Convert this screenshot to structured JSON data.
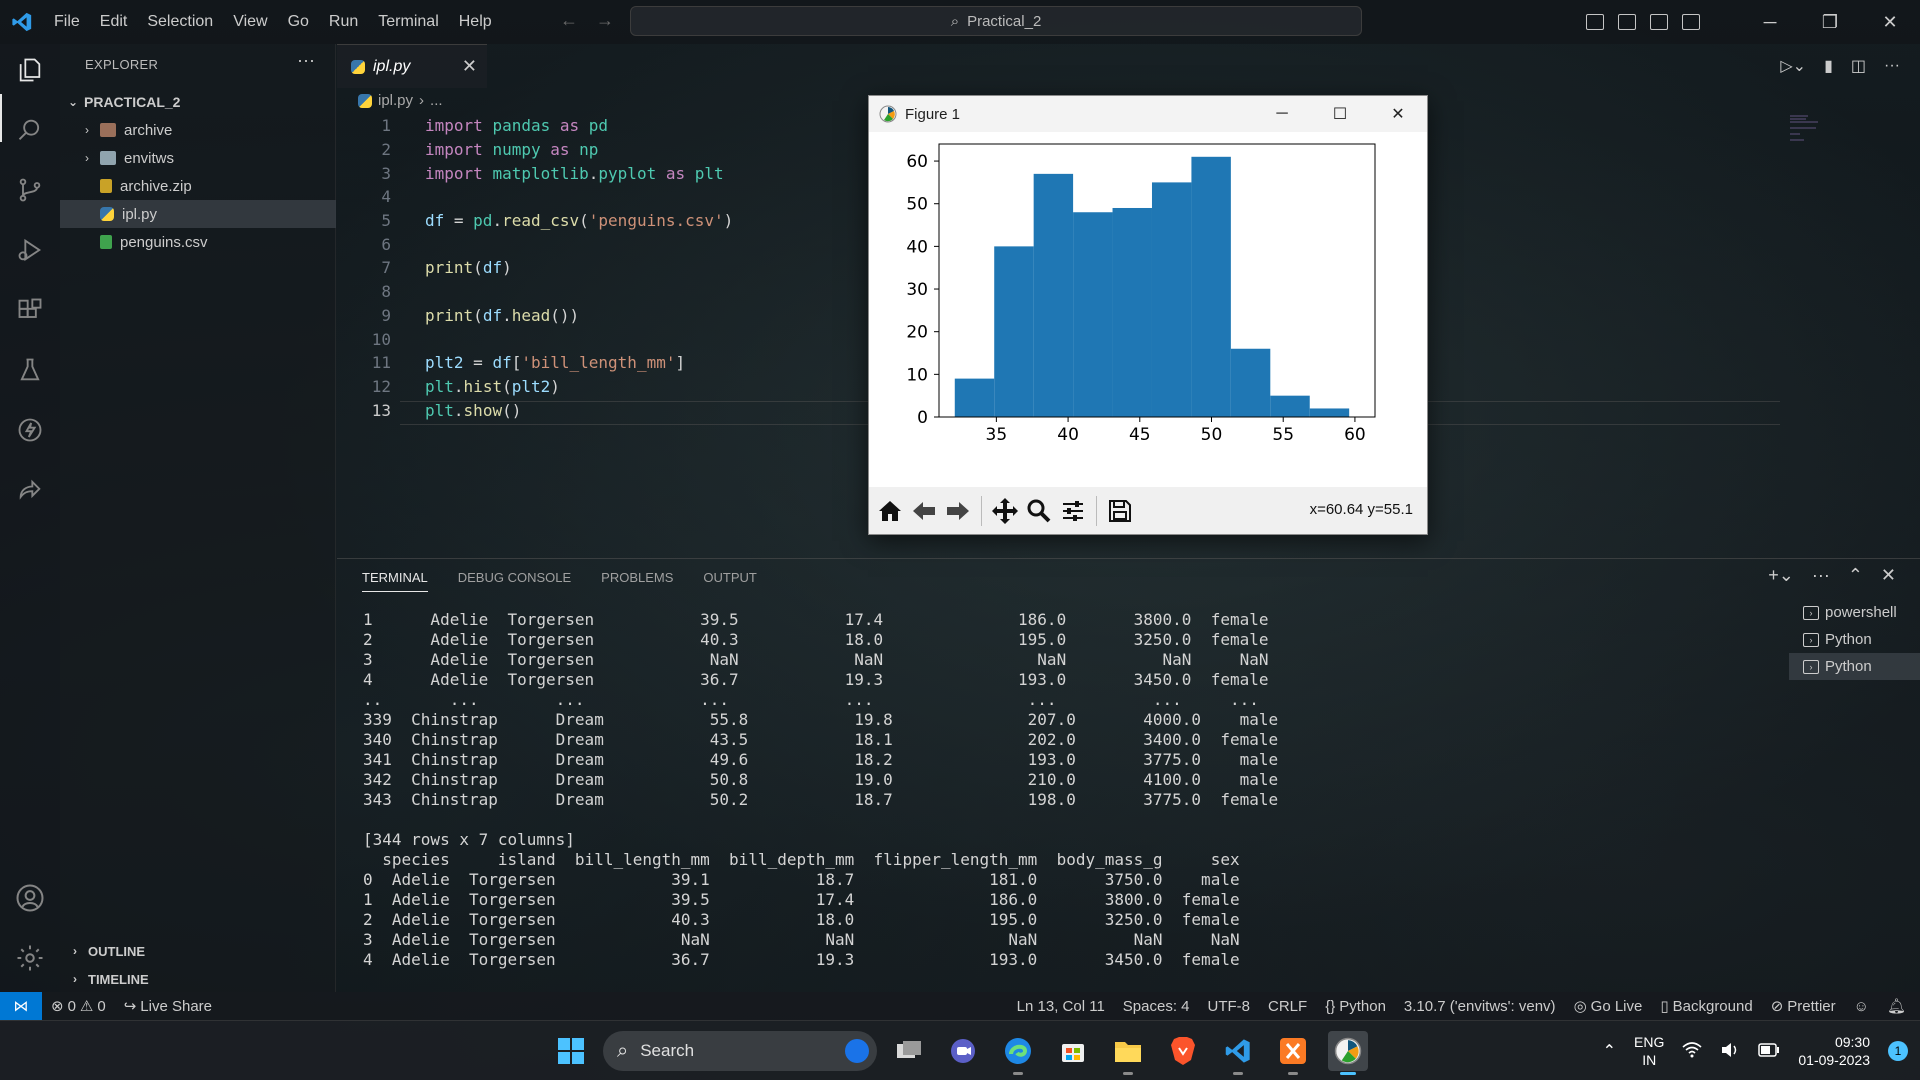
{
  "titlebar": {
    "menu": [
      "File",
      "Edit",
      "Selection",
      "View",
      "Go",
      "Run",
      "Terminal",
      "Help"
    ],
    "search_text": "Practical_2"
  },
  "sidebar": {
    "title": "EXPLORER",
    "project": "PRACTICAL_2",
    "items": [
      {
        "label": "archive",
        "kind": "folder"
      },
      {
        "label": "envitws",
        "kind": "folder"
      },
      {
        "label": "archive.zip",
        "kind": "zip"
      },
      {
        "label": "ipl.py",
        "kind": "python"
      },
      {
        "label": "penguins.csv",
        "kind": "csv"
      }
    ],
    "outline": "OUTLINE",
    "timeline": "TIMELINE"
  },
  "editor": {
    "tab_label": "ipl.py",
    "breadcrumb_file": "ipl.py",
    "breadcrumb_more": "...",
    "current_line": 13,
    "lines": [
      "import pandas as pd",
      "import numpy as np",
      "import matplotlib.pyplot as plt",
      "",
      "df = pd.read_csv('penguins.csv')",
      "",
      "print(df)",
      "",
      "print(df.head())",
      "",
      "plt2 = df['bill_length_mm']",
      "plt.hist(plt2)",
      "plt.show()"
    ]
  },
  "figure": {
    "title": "Figure 1",
    "coords": "x=60.64 y=55.1",
    "chart_data": {
      "type": "bar",
      "title": "",
      "xlabel": "",
      "ylabel": "",
      "x_ticks": [
        35,
        40,
        45,
        50,
        55,
        60
      ],
      "y_ticks": [
        0,
        10,
        20,
        30,
        40,
        50,
        60
      ],
      "xlim": [
        31.0,
        61.4
      ],
      "ylim": [
        0,
        64
      ],
      "bin_edges": [
        32.1,
        34.85,
        37.6,
        40.35,
        43.1,
        45.85,
        48.6,
        51.35,
        54.1,
        56.85,
        59.6
      ],
      "values": [
        9,
        40,
        57,
        48,
        49,
        55,
        61,
        16,
        5,
        2
      ],
      "color": "#1f77b4"
    }
  },
  "panel": {
    "tabs": [
      "TERMINAL",
      "DEBUG CONSOLE",
      "PROBLEMS",
      "OUTPUT"
    ],
    "terminal_lines": [
      "1      Adelie  Torgersen           39.5           17.4              186.0       3800.0  female",
      "2      Adelie  Torgersen           40.3           18.0              195.0       3250.0  female",
      "3      Adelie  Torgersen            NaN            NaN                NaN          NaN     NaN",
      "4      Adelie  Torgersen           36.7           19.3              193.0       3450.0  female",
      "..       ...        ...            ...            ...                ...          ...     ...",
      "339  Chinstrap      Dream           55.8           19.8              207.0       4000.0    male",
      "340  Chinstrap      Dream           43.5           18.1              202.0       3400.0  female",
      "341  Chinstrap      Dream           49.6           18.2              193.0       3775.0    male",
      "342  Chinstrap      Dream           50.8           19.0              210.0       4100.0    male",
      "343  Chinstrap      Dream           50.2           18.7              198.0       3775.0  female",
      "",
      "[344 rows x 7 columns]",
      "  species     island  bill_length_mm  bill_depth_mm  flipper_length_mm  body_mass_g     sex",
      "0  Adelie  Torgersen            39.1           18.7              181.0       3750.0    male",
      "1  Adelie  Torgersen            39.5           17.4              186.0       3800.0  female",
      "2  Adelie  Torgersen            40.3           18.0              195.0       3250.0  female",
      "3  Adelie  Torgersen             NaN            NaN                NaN          NaN     NaN",
      "4  Adelie  Torgersen            36.7           19.3              193.0       3450.0  female"
    ],
    "terminals": [
      "powershell",
      "Python",
      "Python"
    ]
  },
  "statusbar": {
    "errors": "0",
    "warnings": "0",
    "live_share": "Live Share",
    "position": "Ln 13, Col 11",
    "spaces": "Spaces: 4",
    "encoding": "UTF-8",
    "eol": "CRLF",
    "language": "Python",
    "interpreter": "3.10.7 ('envitws': venv)",
    "go_live": "Go Live",
    "background": "Background",
    "prettier": "Prettier"
  },
  "taskbar": {
    "search_label": "Search",
    "lang_top": "ENG",
    "lang_bottom": "IN",
    "time": "09:30",
    "date": "01-09-2023",
    "notification_count": "1"
  }
}
